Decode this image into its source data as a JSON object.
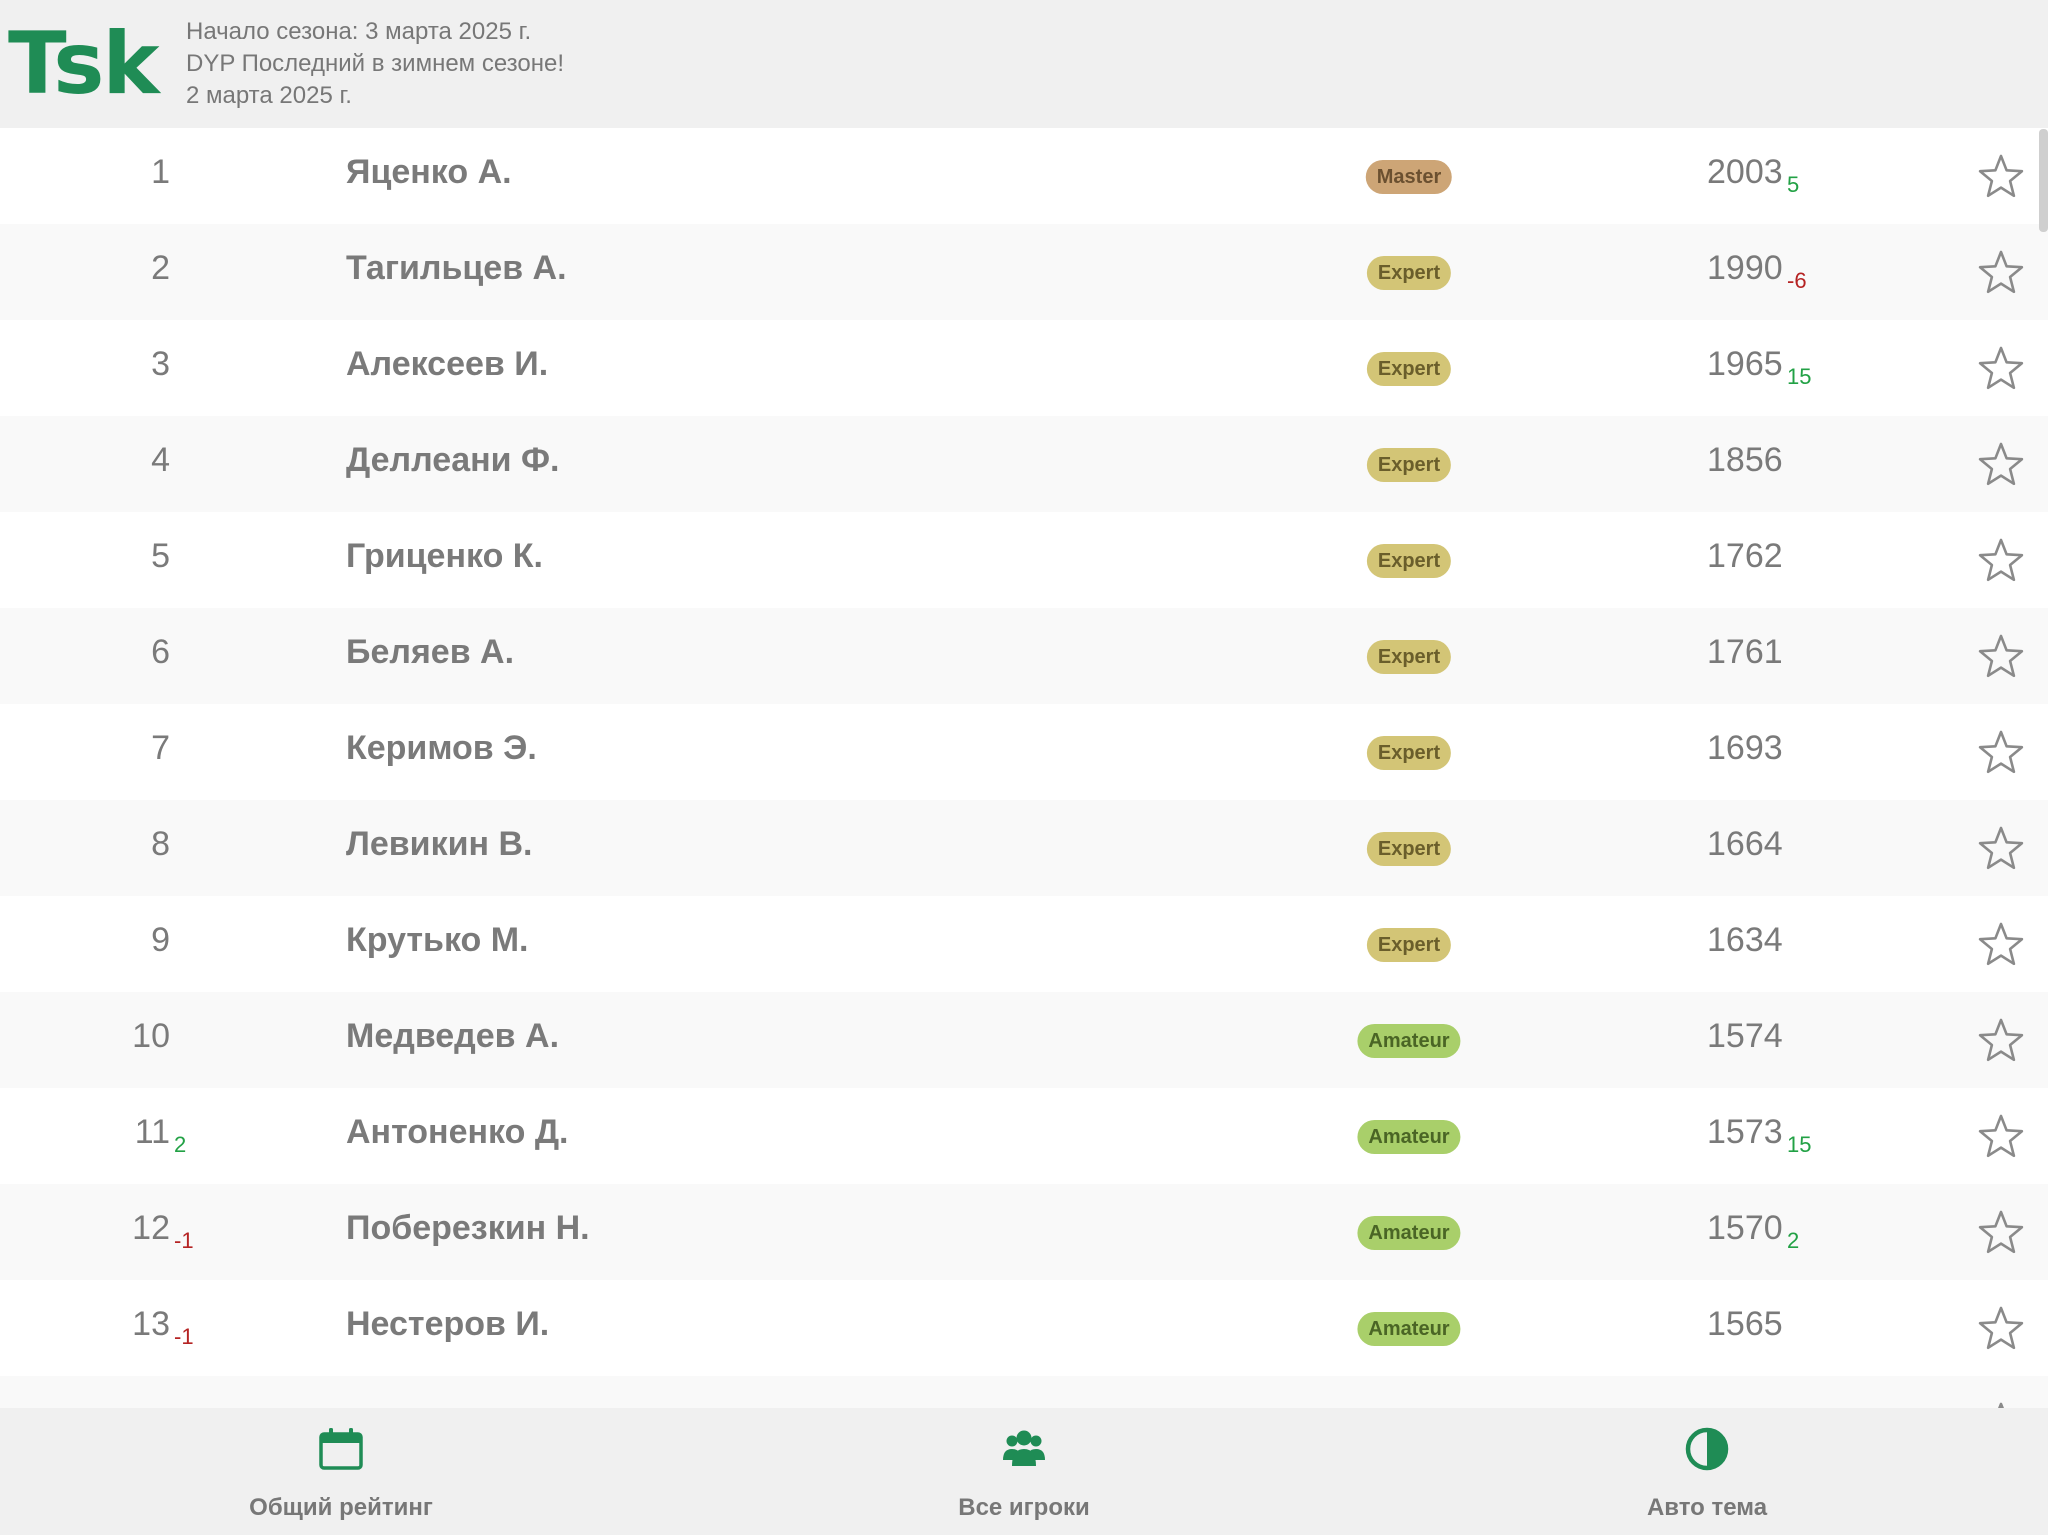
{
  "header": {
    "logo": "Tsk",
    "season_start": "Начало сезона: 3 марта 2025 г.",
    "event_title": "DYP Последний в зимнем сезоне!",
    "event_date": "2 марта 2025 г."
  },
  "colors": {
    "brand": "#1f8c55",
    "positive": "#22a145",
    "negative": "#b52323",
    "badge_master_bg": "#cda576",
    "badge_master_text": "#6b5030",
    "badge_expert_bg": "#d3c576",
    "badge_expert_text": "#6a5e2b",
    "badge_amateur_bg": "#a9cf6a",
    "badge_amateur_text": "#4a6525"
  },
  "rows": [
    {
      "rank": "1",
      "rank_delta": "",
      "name": "Яценко А.",
      "level": "Master",
      "score": "2003",
      "score_delta": "5"
    },
    {
      "rank": "2",
      "rank_delta": "",
      "name": "Тагильцев А.",
      "level": "Expert",
      "score": "1990",
      "score_delta": "-6"
    },
    {
      "rank": "3",
      "rank_delta": "",
      "name": "Алексеев И.",
      "level": "Expert",
      "score": "1965",
      "score_delta": "15"
    },
    {
      "rank": "4",
      "rank_delta": "",
      "name": "Деллеани Ф.",
      "level": "Expert",
      "score": "1856",
      "score_delta": ""
    },
    {
      "rank": "5",
      "rank_delta": "",
      "name": "Гриценко К.",
      "level": "Expert",
      "score": "1762",
      "score_delta": ""
    },
    {
      "rank": "6",
      "rank_delta": "",
      "name": "Беляев А.",
      "level": "Expert",
      "score": "1761",
      "score_delta": ""
    },
    {
      "rank": "7",
      "rank_delta": "",
      "name": "Керимов Э.",
      "level": "Expert",
      "score": "1693",
      "score_delta": ""
    },
    {
      "rank": "8",
      "rank_delta": "",
      "name": "Левикин В.",
      "level": "Expert",
      "score": "1664",
      "score_delta": ""
    },
    {
      "rank": "9",
      "rank_delta": "",
      "name": "Крутько М.",
      "level": "Expert",
      "score": "1634",
      "score_delta": ""
    },
    {
      "rank": "10",
      "rank_delta": "",
      "name": "Медведев А.",
      "level": "Amateur",
      "score": "1574",
      "score_delta": ""
    },
    {
      "rank": "11",
      "rank_delta": "2",
      "name": "Антоненко Д.",
      "level": "Amateur",
      "score": "1573",
      "score_delta": "15"
    },
    {
      "rank": "12",
      "rank_delta": "-1",
      "name": "Поберезкин Н.",
      "level": "Amateur",
      "score": "1570",
      "score_delta": "2"
    },
    {
      "rank": "13",
      "rank_delta": "-1",
      "name": "Нестеров И.",
      "level": "Amateur",
      "score": "1565",
      "score_delta": ""
    }
  ],
  "footer": {
    "nav": [
      {
        "label": "Общий рейтинг",
        "icon": "calendar-icon"
      },
      {
        "label": "Все игроки",
        "icon": "users-icon"
      },
      {
        "label": "Авто тема",
        "icon": "theme-contrast-icon"
      }
    ]
  }
}
